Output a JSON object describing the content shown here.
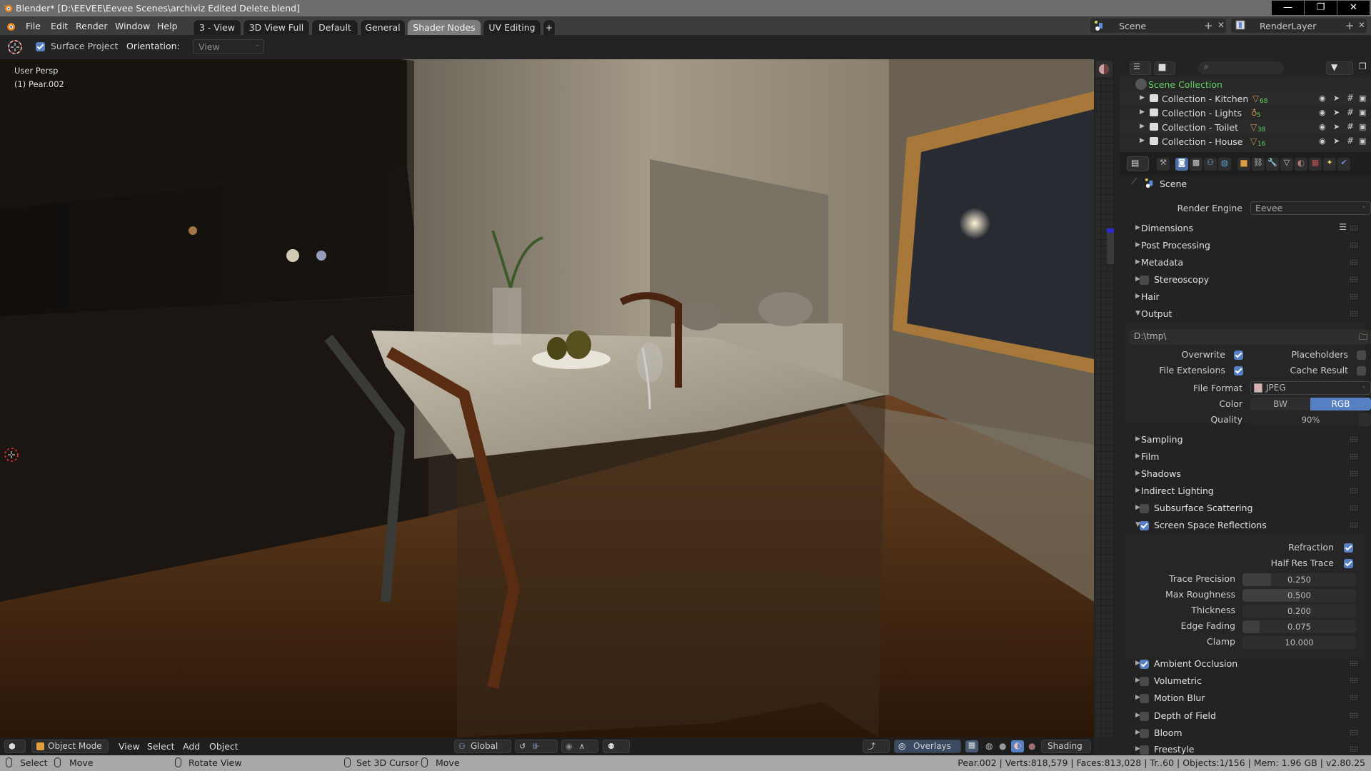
{
  "window": {
    "title": "Blender* [D:\\EEVEE\\Eevee Scenes\\archiviz Edited Delete.blend]",
    "controls": {
      "minimize": "—",
      "maximize": "❐",
      "close": "✕"
    }
  },
  "menubar": {
    "items": [
      "File",
      "Edit",
      "Render",
      "Window",
      "Help"
    ],
    "workspace_tabs": [
      {
        "label": "3 - View",
        "active": false
      },
      {
        "label": "3D View Full",
        "active": false
      },
      {
        "label": "Default",
        "active": false
      },
      {
        "label": "General",
        "active": false
      },
      {
        "label": "Shader Nodes",
        "active": true
      },
      {
        "label": "UV Editing",
        "active": false
      }
    ],
    "add_tab": "+",
    "scene_selector": {
      "value": "Scene",
      "add": "+",
      "remove": "✕"
    },
    "view_layer_selector": {
      "value": "RenderLayer",
      "add": "+",
      "remove": "✕"
    }
  },
  "tool_settings": {
    "surface_project_label": "Surface Project",
    "surface_project_checked": true,
    "orientation_label": "Orientation:",
    "orientation_value": "View"
  },
  "viewport": {
    "view_name": "User Persp",
    "active_object": "(1) Pear.002"
  },
  "outliner": {
    "root": "Scene Collection",
    "collections": [
      {
        "name": "Collection - Kitchen",
        "icon": "mesh-icon",
        "count": "68"
      },
      {
        "name": "Collection - Lights",
        "icon": "light-icon",
        "count": "5"
      },
      {
        "name": "Collection - Toilet",
        "icon": "mesh-icon",
        "count": "38"
      },
      {
        "name": "Collection - House",
        "icon": "mesh-icon",
        "count": "16"
      }
    ]
  },
  "properties": {
    "context": "Scene",
    "render_engine_label": "Render Engine",
    "render_engine_value": "Eevee",
    "panels_top": [
      {
        "label": "Dimensions",
        "expanded": false,
        "has_checkbox": false
      },
      {
        "label": "Post Processing",
        "expanded": false,
        "has_checkbox": false
      },
      {
        "label": "Metadata",
        "expanded": false,
        "has_checkbox": false
      },
      {
        "label": "Stereoscopy",
        "expanded": false,
        "has_checkbox": true,
        "checked": false
      },
      {
        "label": "Hair",
        "expanded": false,
        "has_checkbox": false
      },
      {
        "label": "Output",
        "expanded": true,
        "has_checkbox": false
      }
    ],
    "output": {
      "path": "D:\\tmp\\",
      "overwrite_label": "Overwrite",
      "overwrite": true,
      "placeholders_label": "Placeholders",
      "placeholders": false,
      "file_extensions_label": "File Extensions",
      "file_extensions": true,
      "cache_result_label": "Cache Result",
      "cache_result": false,
      "file_format_label": "File Format",
      "file_format": "JPEG",
      "color_label": "Color",
      "color_options": [
        "BW",
        "RGB"
      ],
      "color_selected": "RGB",
      "quality_label": "Quality",
      "quality": "90%",
      "quality_fraction": 0.9
    },
    "panels_mid": [
      {
        "label": "Sampling",
        "has_checkbox": false
      },
      {
        "label": "Film",
        "has_checkbox": false
      },
      {
        "label": "Shadows",
        "has_checkbox": false
      },
      {
        "label": "Indirect Lighting",
        "has_checkbox": false
      },
      {
        "label": "Subsurface Scattering",
        "has_checkbox": true,
        "checked": false
      },
      {
        "label": "Screen Space Reflections",
        "has_checkbox": true,
        "checked": true,
        "expanded": true
      }
    ],
    "ssr": {
      "refraction_label": "Refraction",
      "refraction": true,
      "half_res_label": "Half Res Trace",
      "half_res": true,
      "fields": [
        {
          "label": "Trace Precision",
          "value": "0.250",
          "fraction": 0.25
        },
        {
          "label": "Max Roughness",
          "value": "0.500",
          "fraction": 0.5
        },
        {
          "label": "Thickness",
          "value": "0.200",
          "fraction": 0.0
        },
        {
          "label": "Edge Fading",
          "value": "0.075",
          "fraction": 0.15
        },
        {
          "label": "Clamp",
          "value": "10.000",
          "fraction": 0.0
        }
      ]
    },
    "panels_bottom": [
      {
        "label": "Ambient Occlusion",
        "checked": true
      },
      {
        "label": "Volumetric",
        "checked": false
      },
      {
        "label": "Motion Blur",
        "checked": false
      },
      {
        "label": "Depth of Field",
        "checked": false
      },
      {
        "label": "Bloom",
        "checked": false
      },
      {
        "label": "Freestyle",
        "checked": false
      }
    ]
  },
  "viewport_header": {
    "mode": "Object Mode",
    "menus": [
      "View",
      "Select",
      "Add",
      "Object"
    ],
    "transform_orientation": "Global",
    "overlays": "Overlays",
    "shading": "Shading"
  },
  "statusbar": {
    "left_select": "Select",
    "left_move": "Move",
    "middle": "Rotate View",
    "right_cursor": "Set 3D Cursor",
    "right_move": "Move",
    "stats": "Pear.002 | Verts:818,579 | Faces:813,028 | Tr..60 | Objects:1/156 | Mem: 1.96 GB | v2.80.25"
  },
  "colors": {
    "accent_blue": "#5680c2",
    "outliner_green": "#5fd35f",
    "active_tab": "#7c7c7c"
  }
}
